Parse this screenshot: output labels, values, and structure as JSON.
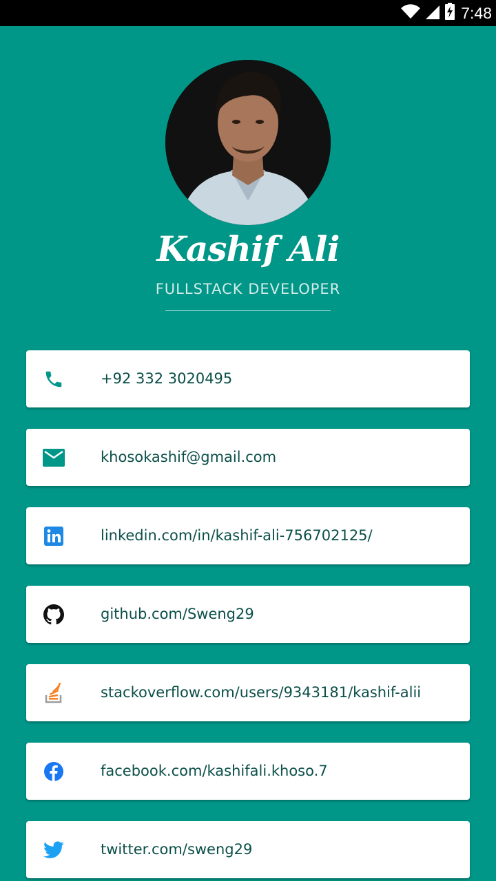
{
  "status_bar": {
    "time": "7:48",
    "icons": [
      "wifi-icon",
      "signal-icon",
      "battery-charging-icon"
    ]
  },
  "profile": {
    "name": "Kashif Ali",
    "role": "FULLSTACK DEVELOPER"
  },
  "contacts": [
    {
      "icon": "phone-icon",
      "text": "+92 332 3020495"
    },
    {
      "icon": "email-icon",
      "text": "khosokashif@gmail.com"
    },
    {
      "icon": "linkedin-icon",
      "text": "linkedin.com/in/kashif-ali-756702125/"
    },
    {
      "icon": "github-icon",
      "text": "github.com/Sweng29"
    },
    {
      "icon": "stackoverflow-icon",
      "text": "stackoverflow.com/users/9343181/kashif-alii"
    },
    {
      "icon": "facebook-icon",
      "text": "facebook.com/kashifali.khoso.7"
    },
    {
      "icon": "twitter-icon",
      "text": "twitter.com/sweng29"
    }
  ],
  "colors": {
    "background": "#009688",
    "card": "#ffffff",
    "text": "#0b4f49",
    "accent": "#009688"
  }
}
